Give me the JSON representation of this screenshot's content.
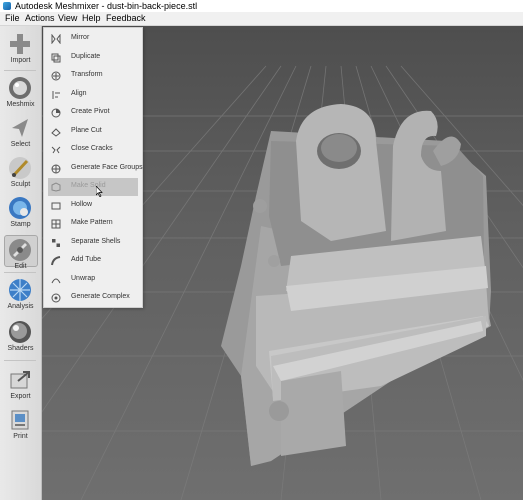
{
  "window": {
    "title": "Autodesk Meshmixer - dust-bin-back-piece.stl"
  },
  "menubar": {
    "items": [
      "File",
      "Actions",
      "View",
      "Help",
      "Feedback"
    ]
  },
  "toolbar": {
    "items": [
      {
        "label": "Import",
        "icon": "plus-icon"
      },
      {
        "label": "Meshmix",
        "icon": "meshmix-sphere-icon"
      },
      {
        "label": "Select",
        "icon": "select-arrow-icon"
      },
      {
        "label": "Sculpt",
        "icon": "sculpt-brush-icon"
      },
      {
        "label": "Stamp",
        "icon": "stamp-icon"
      },
      {
        "label": "Edit",
        "icon": "edit-icon",
        "active": true
      },
      {
        "label": "Analysis",
        "icon": "analysis-sphere-icon"
      },
      {
        "label": "Shaders",
        "icon": "shader-sphere-icon"
      },
      {
        "label": "Export",
        "icon": "export-icon"
      },
      {
        "label": "Print",
        "icon": "print-icon"
      }
    ]
  },
  "edit_menu": {
    "items": [
      {
        "label": "Mirror",
        "icon": "mirror-icon"
      },
      {
        "label": "Duplicate",
        "icon": "duplicate-icon"
      },
      {
        "label": "Transform",
        "icon": "transform-icon"
      },
      {
        "label": "Align",
        "icon": "align-icon"
      },
      {
        "label": "Create Pivot",
        "icon": "pivot-icon"
      },
      {
        "label": "Plane Cut",
        "icon": "plane-cut-icon"
      },
      {
        "label": "Close Cracks",
        "icon": "close-cracks-icon"
      },
      {
        "label": "Generate Face Groups",
        "icon": "face-groups-icon"
      },
      {
        "label": "Make Solid",
        "icon": "make-solid-icon",
        "hovered": true
      },
      {
        "label": "Hollow",
        "icon": "hollow-icon"
      },
      {
        "label": "Make Pattern",
        "icon": "pattern-icon"
      },
      {
        "label": "Separate Shells",
        "icon": "separate-shells-icon"
      },
      {
        "label": "Add Tube",
        "icon": "tube-icon"
      },
      {
        "label": "Unwrap",
        "icon": "unwrap-icon"
      },
      {
        "label": "Generate Complex",
        "icon": "complex-icon"
      }
    ]
  },
  "colors": {
    "viewport_bg": "#5e5e5e",
    "grid": "#7a7a7a",
    "model": "#b4b4b4",
    "menu_bg": "#efefef",
    "hover_bg": "#c6c6c6"
  }
}
